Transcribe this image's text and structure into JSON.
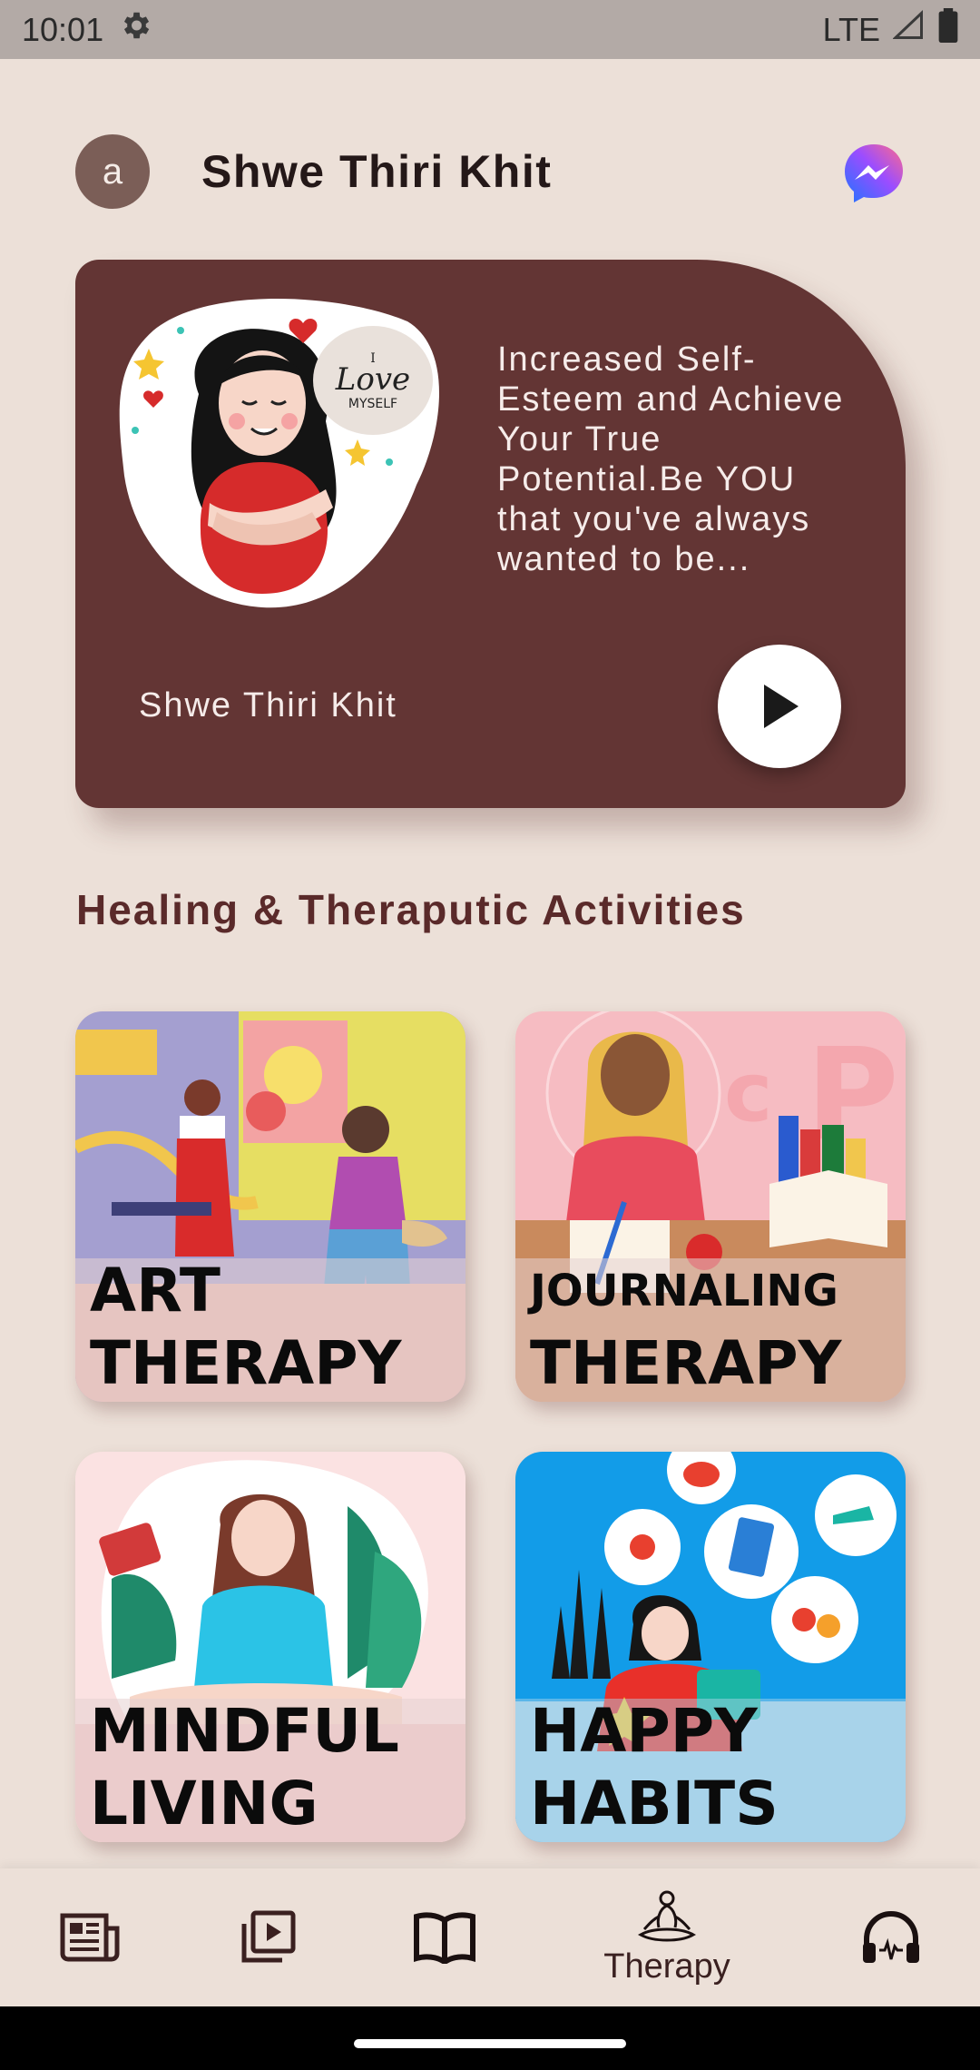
{
  "status_bar": {
    "time": "10:01",
    "network": "LTE"
  },
  "header": {
    "avatar_letter": "a",
    "user_name": "Shwe Thiri Khit"
  },
  "hero": {
    "illustration_text_1": "I",
    "illustration_text_2": "Love",
    "illustration_text_3": "MYSELF",
    "description": "Increased Self-Esteem and Achieve Your True Potential.Be YOU that you've always wanted to be...",
    "author": "Shwe Thiri Khit"
  },
  "section": {
    "title": "Healing & Theraputic Activities"
  },
  "tiles": [
    {
      "line1": "ART",
      "line2": "THERAPY"
    },
    {
      "line1": "JOURNALING",
      "line2": "THERAPY"
    },
    {
      "line1": "MINDFUL",
      "line2": "LIVING"
    },
    {
      "line1": "HAPPY",
      "line2": "HABITS"
    }
  ],
  "bottom_nav": {
    "items": [
      {
        "icon": "news-icon"
      },
      {
        "icon": "video-library-icon"
      },
      {
        "icon": "book-icon"
      },
      {
        "icon": "meditation-icon",
        "label": "Therapy",
        "active": true
      },
      {
        "icon": "headphones-icon"
      }
    ]
  },
  "colors": {
    "hero_bg": "#633534",
    "background": "#ece0d8",
    "accent": "#5a2a2a"
  }
}
